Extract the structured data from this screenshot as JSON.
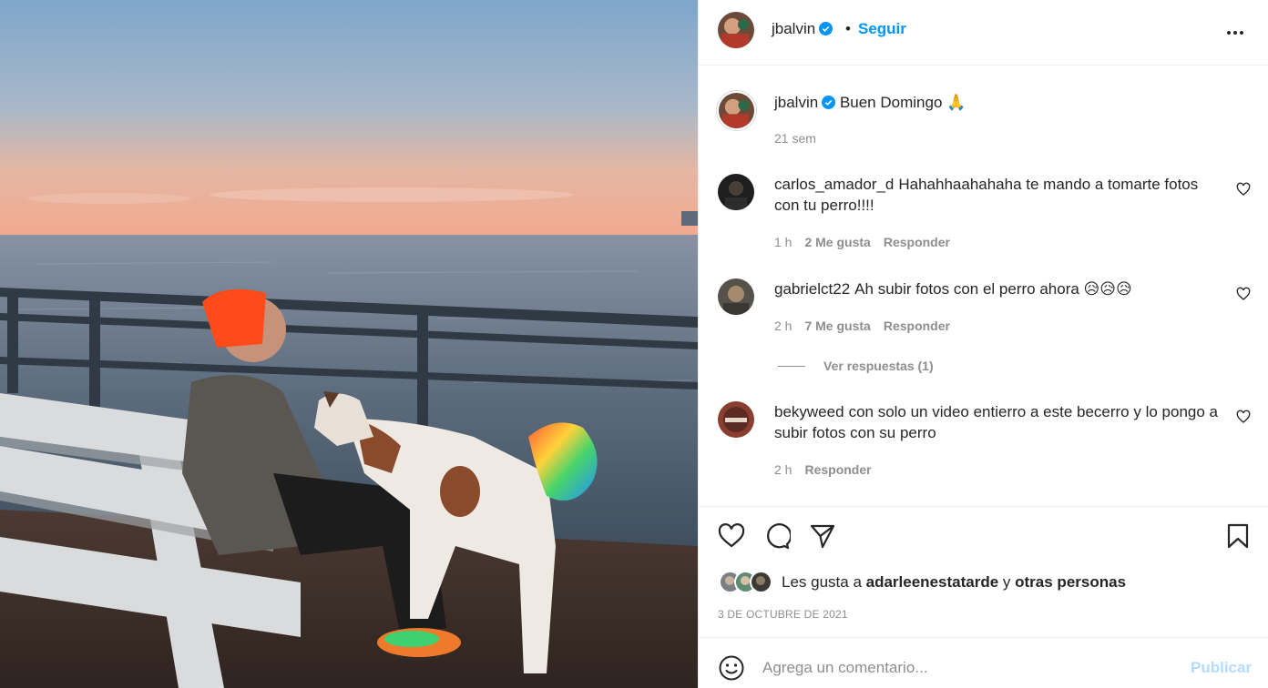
{
  "post": {
    "author": "jbalvin",
    "follow_label": "Seguir",
    "separator": "•",
    "caption_text": "Buen Domingo 🙏",
    "caption_time": "21 sem"
  },
  "comments": [
    {
      "user": "carlos_amador_d",
      "text": "Hahahhaahahaha te mando a tomarte fotos con tu perro!!!!",
      "time": "1 h",
      "likes": "2 Me gusta",
      "reply": "Responder"
    },
    {
      "user": "gabrielct22",
      "text": "Ah subir fotos con el perro ahora 😥😥😥",
      "time": "2 h",
      "likes": "7 Me gusta",
      "reply": "Responder"
    },
    {
      "user": "bekyweed",
      "text": "con solo un video entierro a este becerro y lo pongo a subir fotos con su perro",
      "time": "2 h",
      "reply": "Responder"
    }
  ],
  "view_replies": "Ver respuestas (1)",
  "likes": {
    "prefix": "Les gusta a",
    "user": "adarleenestatarde",
    "connector": "y",
    "others": "otras personas"
  },
  "date": "3 DE OCTUBRE DE 2021",
  "add_comment": {
    "placeholder": "Agrega un comentario...",
    "publish": "Publicar"
  },
  "colors": {
    "link_blue": "#0095f6",
    "publish_disabled": "#b3dbff",
    "secondary_text": "#8e8e8e"
  },
  "icons": [
    "verified-icon",
    "more-icon",
    "heart-icon",
    "comment-icon",
    "share-icon",
    "bookmark-icon",
    "emoji-icon"
  ]
}
